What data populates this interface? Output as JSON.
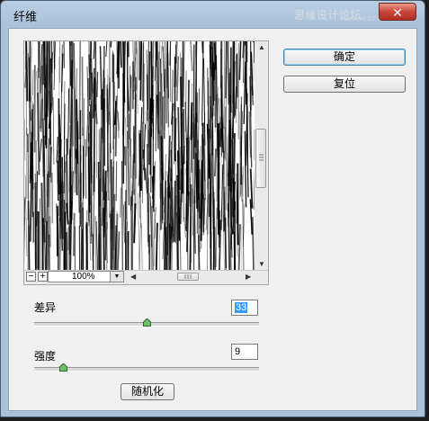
{
  "window": {
    "title": "纤维",
    "watermark": "思缘设计论坛",
    "watermark_url": "www.MISSYUAN.COM",
    "close_symbol": "✕",
    "accent": "#3c7fb1"
  },
  "preview": {
    "zoom_level": "100%",
    "zoom_out_symbol": "−",
    "zoom_in_symbol": "+",
    "dropdown_symbol": "▼"
  },
  "buttons": {
    "ok": "确定",
    "reset": "复位",
    "randomize": "随机化"
  },
  "params": {
    "variance": {
      "label": "差异",
      "value": "33",
      "level": 0.5
    },
    "strength": {
      "label": "强度",
      "value": "9",
      "level": 0.13
    }
  },
  "icons": [
    "close-icon",
    "zoom-out-icon",
    "zoom-in-icon",
    "chevron-down-icon",
    "scroll-up-icon",
    "scroll-down-icon",
    "scroll-left-icon",
    "scroll-right-icon",
    "slider-knob-icon"
  ]
}
